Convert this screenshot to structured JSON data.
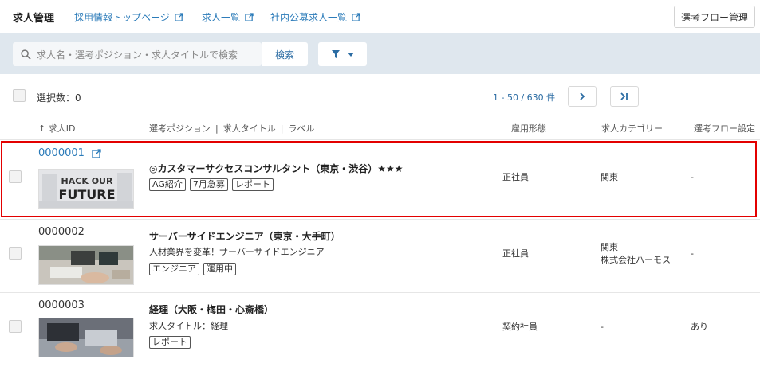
{
  "header": {
    "title": "求人管理",
    "nav": [
      {
        "label": "採用情報トップページ"
      },
      {
        "label": "求人一覧"
      },
      {
        "label": "社内公募求人一覧"
      }
    ],
    "flow_button": "選考フロー管理"
  },
  "search": {
    "placeholder": "求人名・選考ポジション・求人タイトルで検索",
    "button": "検索"
  },
  "toolbar": {
    "selected": "選択数：0",
    "pagination": "1 - 50 / 630 件"
  },
  "columns": {
    "id": "求人ID",
    "position": "選考ポジション",
    "job_title": "求人タイトル",
    "label": "ラベル",
    "employment": "雇用形態",
    "category": "求人カテゴリー",
    "flow": "選考フロー設定"
  },
  "rows": [
    {
      "id": "0000001",
      "thumb_text_1": "HACK OUR",
      "thumb_text_2": "FUTURE",
      "title": "◎カスタマーサクセスコンサルタント（東京・渋谷）★★★",
      "subtitle": "",
      "tags": [
        "AG紹介",
        "7月急募",
        "レポート"
      ],
      "employment": "正社員",
      "category_1": "関東",
      "category_2": "",
      "flow": "-"
    },
    {
      "id": "0000002",
      "title": "サーバーサイドエンジニア（東京・大手町）",
      "subtitle": "人材業界を変革！サーバーサイドエンジニア",
      "tags": [
        "エンジニア",
        "運用中"
      ],
      "employment": "正社員",
      "category_1": "関東",
      "category_2": "株式会社ハーモス",
      "flow": "-"
    },
    {
      "id": "0000003",
      "title": "経理（大阪・梅田・心斎橋）",
      "subtitle": "求人タイトル：経理",
      "tags": [
        "レポート"
      ],
      "employment": "契約社員",
      "category_1": "-",
      "category_2": "",
      "flow": "あり"
    }
  ],
  "colors": {
    "link": "#2b7bb9",
    "search_bar": "#dfe7ee",
    "highlight": "#e30000"
  }
}
